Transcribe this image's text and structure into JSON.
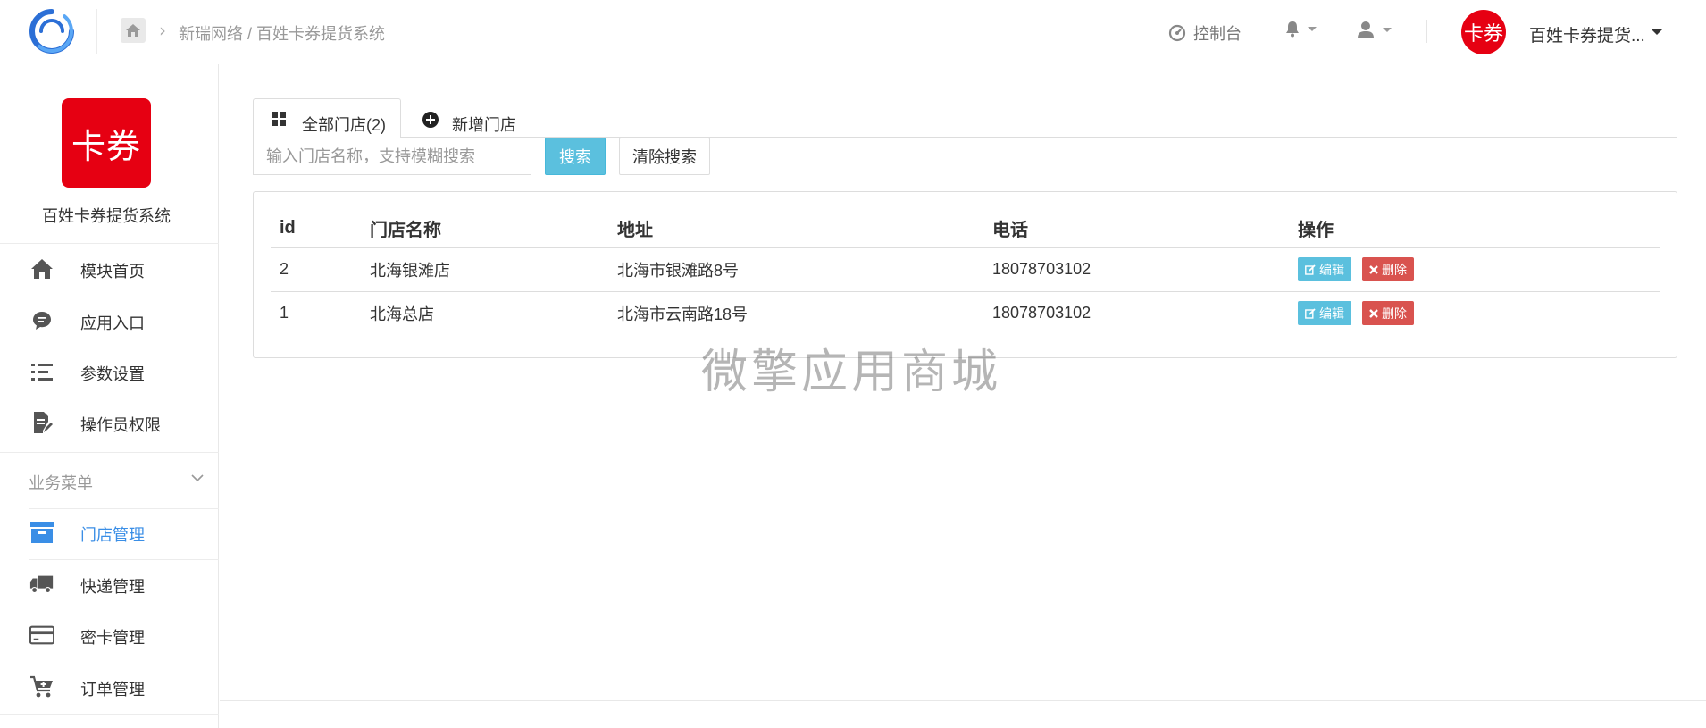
{
  "topbar": {
    "breadcrumb": "新瑞网络 / 百姓卡券提货系统",
    "console_label": "控制台",
    "avatar_text": "卡券",
    "account_name": "百姓卡券提货..."
  },
  "sidebar": {
    "brand_logo_text": "卡券",
    "brand_name": "百姓卡券提货系统",
    "items": [
      {
        "label": "模块首页",
        "icon": "home-icon"
      },
      {
        "label": "应用入口",
        "icon": "chat-bubble-icon"
      },
      {
        "label": "参数设置",
        "icon": "list-settings-icon"
      },
      {
        "label": "操作员权限",
        "icon": "edit-document-icon"
      }
    ],
    "section_title": "业务菜单",
    "business_items": [
      {
        "label": "门店管理",
        "icon": "archive-box-icon",
        "active": true
      },
      {
        "label": "快递管理",
        "icon": "truck-icon"
      },
      {
        "label": "密卡管理",
        "icon": "credit-card-icon"
      },
      {
        "label": "订单管理",
        "icon": "cart-plus-icon"
      }
    ]
  },
  "tabs": {
    "all_stores": "全部门店(2)",
    "add_store": "新增门店"
  },
  "search": {
    "placeholder": "输入门店名称，支持模糊搜索",
    "value": "",
    "search_label": "搜索",
    "clear_label": "清除搜索"
  },
  "table": {
    "headers": [
      "id",
      "门店名称",
      "地址",
      "电话",
      "操作"
    ],
    "rows": [
      {
        "id": "2",
        "name": "北海银滩店",
        "address": "北海市银滩路8号",
        "phone": "18078703102"
      },
      {
        "id": "1",
        "name": "北海总店",
        "address": "北海市云南路18号",
        "phone": "18078703102"
      }
    ],
    "edit_label": "编辑",
    "delete_label": "删除"
  },
  "watermark": "微擎应用商城",
  "colors": {
    "brand_red": "#e60012",
    "accent_blue": "#3a8ee6",
    "info": "#5bc0de",
    "danger": "#d9534f"
  }
}
